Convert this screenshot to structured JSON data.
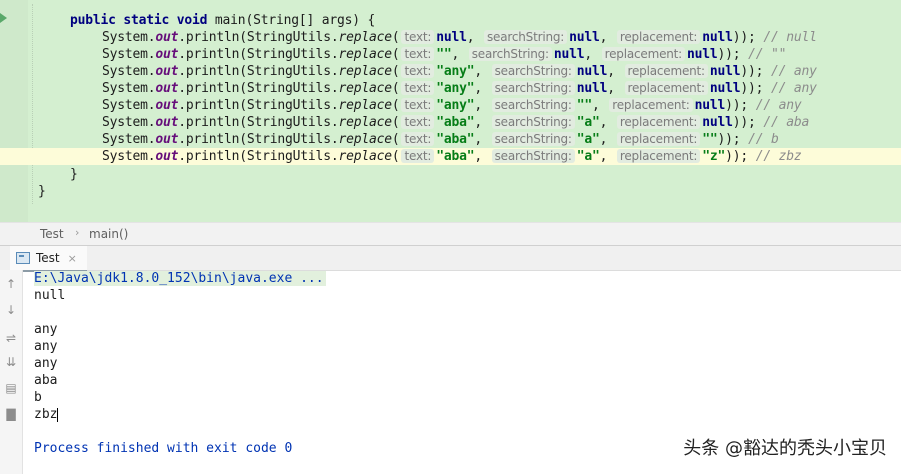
{
  "editor": {
    "method_signature": {
      "modifiers": "public static void",
      "name": "main",
      "params": "(String[] args) {"
    },
    "prefix": {
      "system": "System.",
      "out": "out",
      "println": ".println(StringUtils.",
      "replace": "replace",
      "paren": "("
    },
    "hint_labels": {
      "text": "text:",
      "search": "searchString:",
      "replacement": "replacement:"
    },
    "calls": [
      {
        "text": "null",
        "search": "null",
        "replacement": "null",
        "comment": "// null"
      },
      {
        "text": "\"\"",
        "search": "null",
        "replacement": "null",
        "comment": "// \"\""
      },
      {
        "text": "\"any\"",
        "search": "null",
        "replacement": "null",
        "comment": "// any"
      },
      {
        "text": "\"any\"",
        "search": "null",
        "replacement": "null",
        "comment": "// any"
      },
      {
        "text": "\"any\"",
        "search": "\"\"",
        "replacement": "null",
        "comment": "// any"
      },
      {
        "text": "\"aba\"",
        "search": "\"a\"",
        "replacement": "null",
        "comment": "// aba"
      },
      {
        "text": "\"aba\"",
        "search": "\"a\"",
        "replacement": "\"\"",
        "comment": "// b"
      },
      {
        "text": "\"aba\"",
        "search": "\"a\"",
        "replacement": "\"z\"",
        "comment": "// zbz"
      }
    ],
    "closing_inner": "}",
    "closing_outer": "}"
  },
  "breadcrumb": {
    "items": [
      "Test",
      "main()"
    ],
    "separator": "›"
  },
  "run_window": {
    "tab_label": "Test",
    "tab_close": "×",
    "command": "E:\\Java\\jdk1.8.0_152\\bin\\java.exe ...",
    "output_lines": [
      "null",
      "",
      "any",
      "any",
      "any",
      "aba",
      "b",
      "zbz"
    ],
    "exit_message": "Process finished with exit code 0"
  },
  "toolbar_icons": [
    "up-arrow-icon",
    "down-arrow-icon",
    "soft-wrap-icon",
    "scroll-to-end-icon",
    "print-icon",
    "trash-icon"
  ],
  "watermark": "头条 @豁达的秃头小宝贝"
}
